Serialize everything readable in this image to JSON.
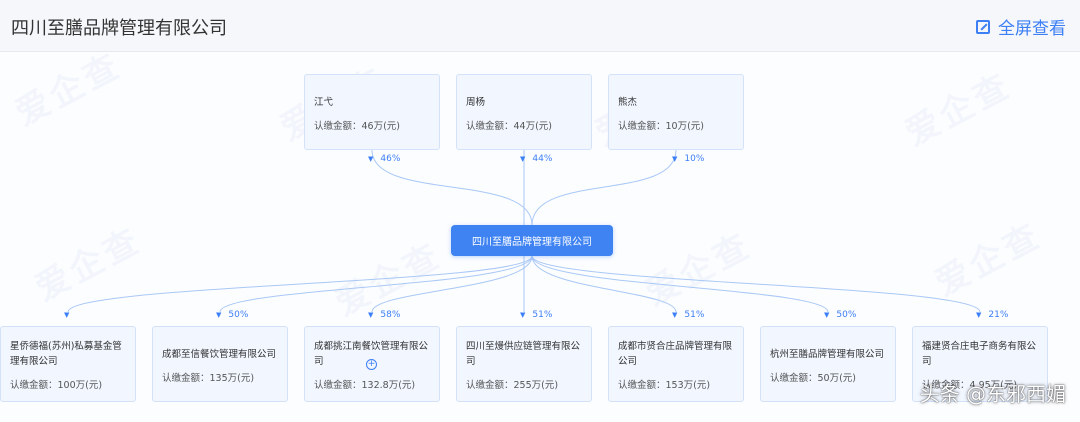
{
  "header": {
    "title": "四川至膳品牌管理有限公司",
    "fullscreen_label": "全屏查看"
  },
  "watermark_text": "爱企查",
  "center_node": {
    "name": "四川至膳品牌管理有限公司"
  },
  "shareholders": [
    {
      "name": "江弋",
      "amount": "认缴金额：46万(元)",
      "percent": "46%"
    },
    {
      "name": "周杨",
      "amount": "认缴金额：44万(元)",
      "percent": "44%"
    },
    {
      "name": "熊杰",
      "amount": "认缴金额：10万(元)",
      "percent": "10%"
    }
  ],
  "investments": [
    {
      "name": "星侨德福(苏州)私募基金管理有限公司",
      "amount": "认缴金额：100万(元)",
      "percent": ""
    },
    {
      "name": "成都至信餐饮管理有限公司",
      "amount": "认缴金额：135万(元)",
      "percent": "50%"
    },
    {
      "name": "成都挑江南餐饮管理有限公司",
      "amount": "认缴金额：132.8万(元)",
      "percent": "58%"
    },
    {
      "name": "四川至熳供应链管理有限公司",
      "amount": "认缴金额：255万(元)",
      "percent": "51%"
    },
    {
      "name": "成都市贤合庄品牌管理有限公司",
      "amount": "认缴金额：153万(元)",
      "percent": "51%"
    },
    {
      "name": "杭州至膳品牌管理有限公司",
      "amount": "认缴金额：50万(元)",
      "percent": "50%"
    },
    {
      "name": "福建贤合庄电子商务有限公司",
      "amount": "认缴金额：4.95万(元)",
      "percent": "21%"
    }
  ],
  "expand_symbol": "+",
  "credit": "头条 @东邪西媚",
  "colors": {
    "accent": "#3f83f3",
    "node_bg": "#f1f6ff",
    "link": "#a9c8f5"
  }
}
